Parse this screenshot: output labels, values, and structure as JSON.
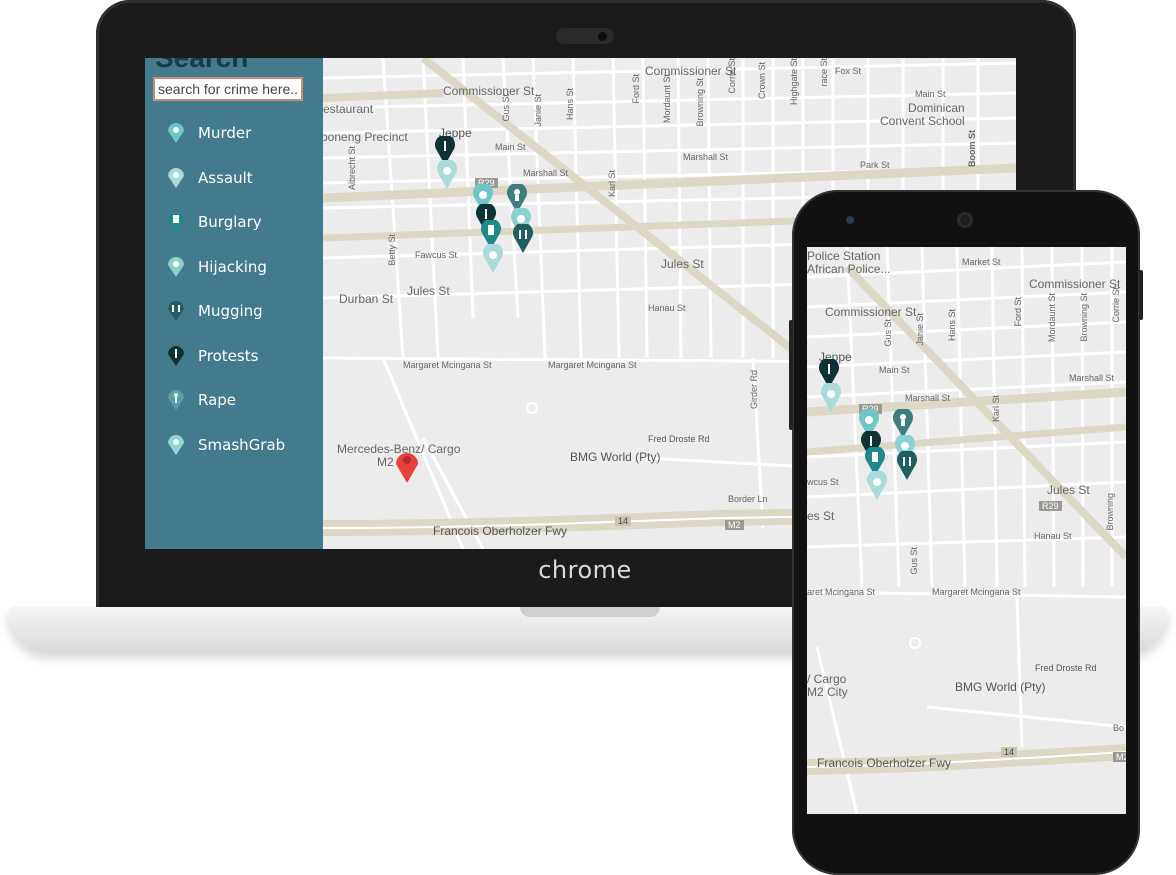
{
  "device": {
    "brand_label": "chrome"
  },
  "sidebar": {
    "title": "Search",
    "search_placeholder": "search for crime here..",
    "items": [
      {
        "label": "Murder",
        "icon": "murder-icon",
        "color": "#6fc6c8"
      },
      {
        "label": "Assault",
        "icon": "assault-icon",
        "color": "#a9dcd9"
      },
      {
        "label": "Burglary",
        "icon": "burglary-icon",
        "color": "#1f8a8c"
      },
      {
        "label": "Hijacking",
        "icon": "hijacking-icon",
        "color": "#8dd0cf"
      },
      {
        "label": "Mugging",
        "icon": "mugging-icon",
        "color": "#1f5f62"
      },
      {
        "label": "Protests",
        "icon": "protests-icon",
        "color": "#0f3335"
      },
      {
        "label": "Rape",
        "icon": "rape-icon",
        "color": "#5a9ea3"
      },
      {
        "label": "SmashGrab",
        "icon": "smashgrab-icon",
        "color": "#8fd6d5"
      }
    ]
  },
  "laptop_map": {
    "labels": {
      "commissioner_st_top": "Commissioner St",
      "fox_st": "Fox St",
      "main_st_right": "Main St",
      "restaurant": "estaurant",
      "precinct": "poneng Precinct",
      "commissioner_st": "Commissioner St",
      "jeppe": "Jeppe",
      "main_st": "Main St",
      "dominican": "Dominican",
      "convent_school": "Convent School",
      "marshall_st": "Marshall St",
      "marshall_st_2": "Marshall St",
      "park_st": "Park St",
      "fawcus_st": "Fawcus St",
      "jules_st": "Jules St",
      "jules_st_2": "Jules St",
      "durban_st": "Durban St",
      "hanau_st": "Hanau St",
      "margaret_1": "Margaret Mcingana St",
      "margaret_2": "Margaret Mcingana St",
      "fred_droste": "Fred Droste Rd",
      "mercedes_1": "Mercedes-Benz/ Cargo",
      "mercedes_2": "M2 City",
      "bmg_world": "BMG World (Pty)",
      "border_ln": "Border Ln",
      "francois": "Francois Oberholzer Fwy",
      "route_14": "14",
      "route_m2": "M2",
      "route_r29": "R29",
      "gus_st": "Gus St",
      "janie_st": "Janie St",
      "hans_st": "Hans St",
      "ford_st": "Ford St",
      "mordaunt_st": "Mordaunt St",
      "browning_st": "Browning St",
      "corrie_st": "Corrie St",
      "crown_st": "Crown St",
      "highgate_st": "Highgate St",
      "terrace_st": "race St",
      "albrecht_st": "Albrecht St",
      "betty_st": "Betty St",
      "karl_st": "Karl St",
      "boom_st": "Boom St",
      "girder_rd": "Girder Rd"
    }
  },
  "phone_map": {
    "labels": {
      "police_1": "Police Station",
      "police_2": "African Police...",
      "market_st": "Market St",
      "commissioner_st_r": "Commissioner St",
      "commissioner_st": "Commissioner St",
      "jeppe": "Jeppe",
      "main_st": "Main St",
      "marshall_st": "Marshall St",
      "marshall_st_2": "Marshall St",
      "fawcus_st": "wcus St",
      "jules_st": "Jules St",
      "es_st": "es St",
      "hanau_st": "Hanau St",
      "margaret_1": "aret Mcingana St",
      "margaret_2": "Margaret Mcingana St",
      "fred_droste": "Fred Droste Rd",
      "cargo_1": "/ Cargo",
      "cargo_2": "M2 City",
      "bmg_world": "BMG World (Pty)",
      "francois": "Francois Oberholzer Fwy",
      "route_14": "14",
      "route_r29": "R29",
      "route_r29_b": "R29",
      "route_m2": "M2",
      "gus_st": "Gus St",
      "janie_st": "Janie St",
      "hans_st": "Hans St",
      "ford_st": "Ford St",
      "mordaunt_st": "Mordaunt St",
      "browning_st": "Browning St",
      "corrie_st": "Corrie St",
      "karl_st": "Karl St",
      "gus_st_2": "Gus St",
      "browning_st_2": "Browning",
      "bo": "Bo"
    }
  }
}
